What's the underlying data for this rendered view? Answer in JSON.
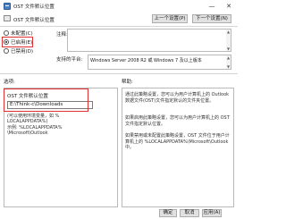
{
  "window": {
    "title": "OST 文件默认位置",
    "minimize": "—",
    "close": "✕"
  },
  "header": {
    "setting_name": "OST 文件默认位置",
    "prev_button": "上一个设置(P)",
    "next_button": "下一个设置(N)"
  },
  "state": {
    "options": [
      {
        "label": "未配置(C)",
        "checked": false
      },
      {
        "label": "已启用(E)",
        "checked": true
      },
      {
        "label": "已禁用(D)",
        "checked": false
      }
    ]
  },
  "comment": {
    "label": "注释:"
  },
  "platform": {
    "label": "支持的平台:",
    "value": "Windows Server 2008 R2 或 Windows 7 及以上版本"
  },
  "options_panel": {
    "label": "选项:",
    "field_label": "OST 文件默认位置",
    "field_value": "E:\\Think-c\\Downloads",
    "notes": [
      "(可以使用环境变量，如 %",
      "LOCALAPPDATA%)",
      "示例: %LOCALAPPDATA%",
      "\\Microsoft\\Outlook"
    ]
  },
  "help_panel": {
    "label": "帮助:",
    "paragraphs": [
      "通过此策略设置，您可以为用户计算机上的 Outlook 数据文件(OST)文件指定默认的文件夹位置。",
      "如果启用此策略设置，您可以为用户计算机上的 OST 文件指定默认位置。",
      "如果禁用或未配置此策略设置，OST 文件位于用户计算机上的 %LOCALAPPDATA%\\Microsoft\\Outlook 中。"
    ]
  },
  "footer": {
    "ok": "确定",
    "cancel": "取消",
    "apply": "应用(A)"
  },
  "colors": {
    "highlight": "#e03030",
    "button_bg": "#e1e1e1",
    "border": "#b9b9b9"
  },
  "icons": [
    "policy-setting-icon",
    "minimize-icon",
    "close-icon",
    "scroll-up-icon",
    "scroll-down-icon"
  ]
}
